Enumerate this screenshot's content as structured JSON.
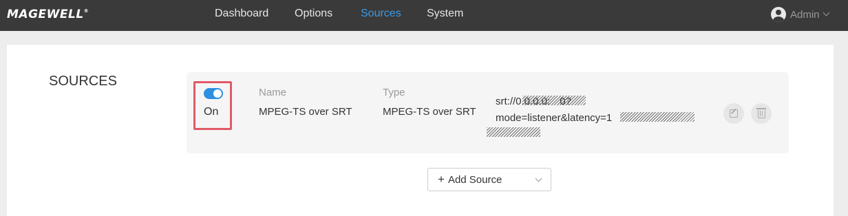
{
  "header": {
    "logo": "MAGEWELL",
    "logo_mark": "®",
    "nav": [
      {
        "label": "Dashboard",
        "active": false
      },
      {
        "label": "Options",
        "active": false
      },
      {
        "label": "Sources",
        "active": true
      },
      {
        "label": "System",
        "active": false
      }
    ],
    "user": {
      "name": "Admin",
      "icon": "user-avatar-icon"
    }
  },
  "section": {
    "title": "SOURCES"
  },
  "sources": [
    {
      "enabled": true,
      "toggle_label": "On",
      "name_label": "Name",
      "name_value": "MPEG-TS over SRT",
      "type_label": "Type",
      "type_value": "MPEG-TS over SRT",
      "url_line1": "srt://0.0.0.0:",
      "url_line1_end": "0?",
      "url_line2": "mode=listener&latency=1",
      "actions": [
        "edit-icon",
        "trash-icon"
      ]
    }
  ],
  "add_source": {
    "label": "Add Source",
    "icon": "plus-icon"
  },
  "colors": {
    "accent": "#2f8fe0",
    "nav_active": "#3a9be6",
    "highlight_border": "#e05a66",
    "topbar": "#3a3a3a"
  }
}
